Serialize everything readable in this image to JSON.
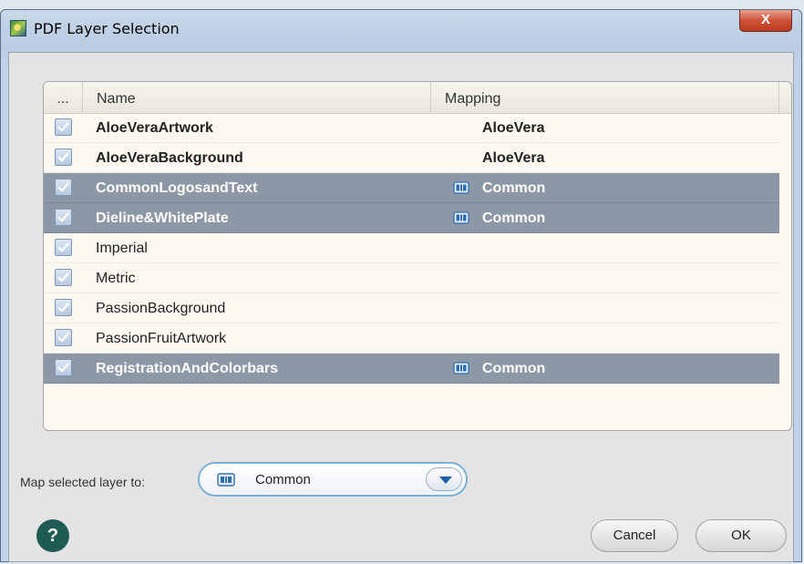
{
  "window": {
    "title": "PDF Layer Selection",
    "close_label": "X"
  },
  "table": {
    "columns": {
      "select": "...",
      "name": "Name",
      "mapping": "Mapping"
    },
    "rows": [
      {
        "checked": true,
        "name": "AloeVeraArtwork",
        "mapping": "AloeVera",
        "selected": false,
        "bold": true,
        "icon": ""
      },
      {
        "checked": true,
        "name": "AloeVeraBackground",
        "mapping": "AloeVera",
        "selected": false,
        "bold": true,
        "icon": ""
      },
      {
        "checked": true,
        "name": "CommonLogosandText",
        "mapping": "Common",
        "selected": true,
        "bold": true,
        "icon": "layer-icon"
      },
      {
        "checked": true,
        "name": "Dieline&WhitePlate",
        "mapping": "Common",
        "selected": true,
        "bold": true,
        "icon": "layer-icon"
      },
      {
        "checked": true,
        "name": "Imperial",
        "mapping": "",
        "selected": false,
        "bold": false,
        "icon": ""
      },
      {
        "checked": true,
        "name": "Metric",
        "mapping": "",
        "selected": false,
        "bold": false,
        "icon": ""
      },
      {
        "checked": true,
        "name": "PassionBackground",
        "mapping": "",
        "selected": false,
        "bold": false,
        "icon": ""
      },
      {
        "checked": true,
        "name": "PassionFruitArtwork",
        "mapping": "",
        "selected": false,
        "bold": false,
        "icon": ""
      },
      {
        "checked": true,
        "name": "RegistrationAndColorbars",
        "mapping": "Common",
        "selected": true,
        "bold": true,
        "icon": "layer-icon"
      }
    ]
  },
  "map_selected": {
    "label": "Map selected layer to:",
    "value": "Common"
  },
  "buttons": {
    "help": "?",
    "cancel": "Cancel",
    "ok": "OK"
  },
  "colors": {
    "selected_row": "#8c98a5",
    "help_button": "#1e5b52",
    "accent": "#7ab0d6"
  }
}
